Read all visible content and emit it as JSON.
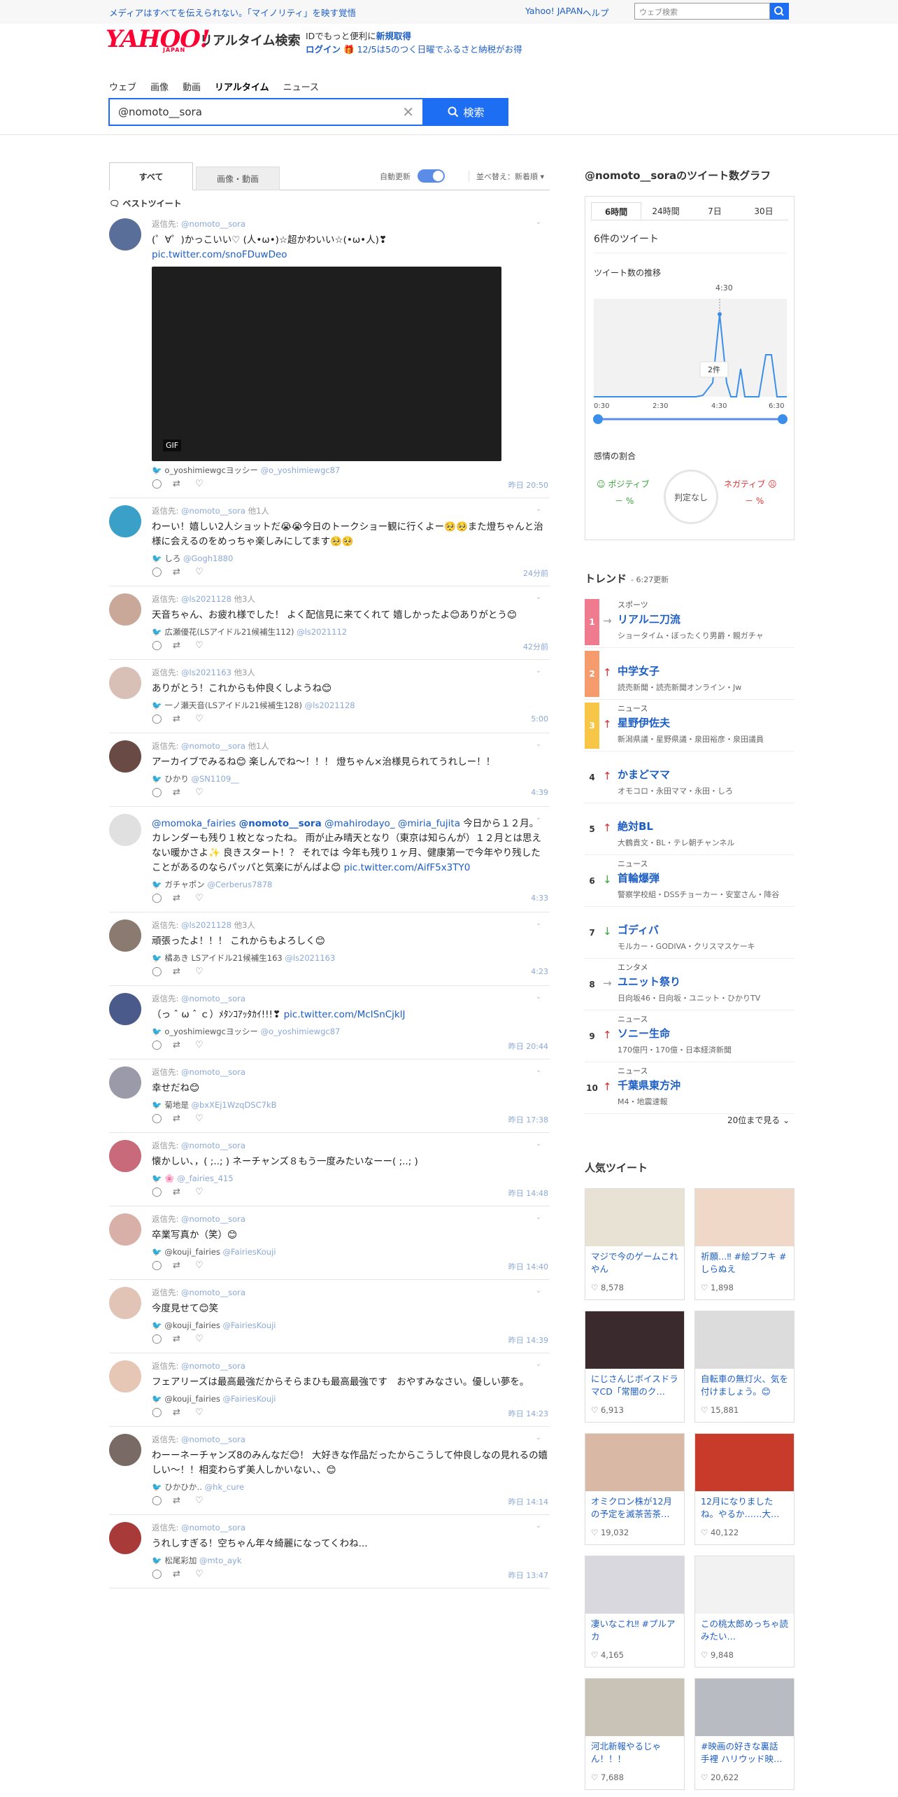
{
  "topbar": {
    "promo": "メディアはすべてを伝えられない。「マイノリティ」を映す覚悟",
    "yahoo_japan": "Yahoo! JAPAN",
    "help": "ヘルプ",
    "search_placeholder": "ウェブ検索"
  },
  "header": {
    "logo_text": "YAHOO!",
    "logo_sub": "JAPAN",
    "site_title": "リアルタイム検索",
    "promo_line1_a": "IDでもっと便利に",
    "promo_line1_b": "新規取得",
    "promo_line2_a": "ログイン",
    "promo_line2_b": "12/5は5のつく日曜でふるさと納税がお得"
  },
  "nav": [
    "ウェブ",
    "画像",
    "動画",
    "リアルタイム",
    "ニュース"
  ],
  "search": {
    "query": "@nomoto__sora",
    "button": "検索"
  },
  "tabs": {
    "all": "すべて",
    "media": "画像・動画",
    "auto_update": "自動更新",
    "sort": "並べ替え：新着順"
  },
  "best_label": "ベストツイート",
  "tweets": [
    {
      "reply_prefix": "返信先:",
      "reply": "@nomoto__sora",
      "reply_extra": "",
      "text": "(゜∀゜)かっこいい♡ (人•ω•)☆超かわいい☆(•ω•人)❣",
      "link": "pic.twitter.com/snoFDuwDeo",
      "has_gif": true,
      "gif_label": "GIF",
      "user_name": "o_yoshimiewgcヨッシー",
      "user_handle": "@o_yoshimiewgc87",
      "time": "昨日 20:50"
    },
    {
      "reply_prefix": "返信先:",
      "reply": "@nomoto__sora",
      "reply_extra": "他1人",
      "text": "わーい！嬉しい2人ショットだ😭😭今日のトークショー観に行くよー🥺🥺また燈ちゃんと治様に会えるのをめっちゃ楽しみにしてます🥺🥺",
      "link": "",
      "has_gif": false,
      "user_name": "しろ",
      "user_handle": "@Gogh1880",
      "time": "24分前"
    },
    {
      "reply_prefix": "返信先:",
      "reply": "@ls2021128",
      "reply_extra": "他3人",
      "text": "天音ちゃん、お疲れ様でした！ よく配信見に来てくれて 嬉しかったよ😊ありがとう😊",
      "link": "",
      "has_gif": false,
      "user_name": "広瀬優花(LSアイドル21候補生112)",
      "user_handle": "@ls2021112",
      "time": "42分前"
    },
    {
      "reply_prefix": "返信先:",
      "reply": "@ls2021163",
      "reply_extra": "他3人",
      "text": "ありがとう！これからも仲良くしようね😊",
      "link": "",
      "has_gif": false,
      "user_name": "一ノ瀬天音(LSアイドル21候補生128)",
      "user_handle": "@ls2021128",
      "time": "5:00"
    },
    {
      "reply_prefix": "返信先:",
      "reply": "@nomoto__sora",
      "reply_extra": "他1人",
      "text": "アーカイブでみるね😊 楽しんでね〜！！！ 燈ちゃん×治様見られてうれしー！！",
      "link": "",
      "has_gif": false,
      "user_name": "ひかり",
      "user_handle": "@SN1109__",
      "time": "4:39"
    },
    {
      "reply_prefix": "",
      "reply": "",
      "reply_extra": "",
      "text_rich": true,
      "m1": "@momoka_fairies",
      "m2": "@nomoto__sora",
      "m3": "@mahirodayo_",
      "m4": "@miria_fujita",
      "text": "今日から１２月。 カレンダーも残り１枚となったね。 雨が止み晴天となり（東京は知らんが）１２月とは思えない暖かさよ✨ 良きスタート！？ それでは 今年も残り１ヶ月、健康第一で今年やり残したことがあるのならパッパと気楽にがんばよ😊",
      "link": "pic.twitter.com/AifF5x3TY0",
      "has_gif": false,
      "user_name": "ガチャポン",
      "user_handle": "@Cerberus7878",
      "time": "4:33"
    },
    {
      "reply_prefix": "返信先:",
      "reply": "@ls2021128",
      "reply_extra": "他3人",
      "text": "頑張ったよ！！！ これからもよろしく😊",
      "link": "",
      "has_gif": false,
      "user_name": "橘あき LSアイドル21候補生163",
      "user_handle": "@ls2021163",
      "time": "4:23"
    },
    {
      "reply_prefix": "返信先:",
      "reply": "@nomoto__sora",
      "reply_extra": "",
      "text": "（っ ˆ ω ˆ ｃ）ﾒﾀﾝｺｱｯﾀｶｲ!!!❣",
      "link": "pic.twitter.com/McISnCjklJ",
      "has_gif": false,
      "user_name": "o_yoshimiewgcヨッシー",
      "user_handle": "@o_yoshimiewgc87",
      "time": "昨日 20:44"
    },
    {
      "reply_prefix": "返信先:",
      "reply": "@nomoto__sora",
      "reply_extra": "",
      "text": "幸せだね😊",
      "link": "",
      "has_gif": false,
      "user_name": "菊地是",
      "user_handle": "@bxXEj1WzqDSC7kB",
      "time": "昨日 17:38"
    },
    {
      "reply_prefix": "返信先:",
      "reply": "@nomoto__sora",
      "reply_extra": "",
      "text": "懐かしい、，( ;..; ) ネーチャンズ８もう一度みたいなーー( ;..; )",
      "link": "",
      "has_gif": false,
      "user_name": "🌸",
      "user_handle": "@_fairies_415",
      "time": "昨日 14:48"
    },
    {
      "reply_prefix": "返信先:",
      "reply": "@nomoto__sora",
      "reply_extra": "",
      "text": "卒業写真か（笑）😊",
      "link": "",
      "has_gif": false,
      "user_name": "@kouji_fairies",
      "user_handle": "@FairiesKouji",
      "time": "昨日 14:40"
    },
    {
      "reply_prefix": "返信先:",
      "reply": "@nomoto__sora",
      "reply_extra": "",
      "text": "今度見せて😊笑",
      "link": "",
      "has_gif": false,
      "user_name": "@kouji_fairies",
      "user_handle": "@FairiesKouji",
      "time": "昨日 14:39"
    },
    {
      "reply_prefix": "返信先:",
      "reply": "@nomoto__sora",
      "reply_extra": "",
      "text": "フェアリーズは最高最強だからそらまひも最高最強です　おやすみなさい。優しい夢を。",
      "link": "",
      "has_gif": false,
      "user_name": "@kouji_fairies",
      "user_handle": "@FairiesKouji",
      "time": "昨日 14:23"
    },
    {
      "reply_prefix": "返信先:",
      "reply": "@nomoto__sora",
      "reply_extra": "",
      "text": "わーーネーチャンズ8のみんなだ😊！ 大好きな作品だったからこうして仲良しなの見れるの嬉しい〜！！相変わらず美人しかいない、、😊",
      "link": "",
      "has_gif": false,
      "user_name": "ひかひか‥",
      "user_handle": "@hk_cure",
      "time": "昨日 14:14"
    },
    {
      "reply_prefix": "返信先:",
      "reply": "@nomoto__sora",
      "reply_extra": "",
      "text": "うれしすぎる！空ちゃん年々綺麗になってくわね...",
      "link": "",
      "has_gif": false,
      "user_name": "松尾彩加",
      "user_handle": "@mto_ayk",
      "time": "昨日 13:47"
    }
  ],
  "graph": {
    "title": "@nomoto__soraのツイート数グラフ",
    "tabs": [
      "6時間",
      "24時間",
      "7日",
      "30日"
    ],
    "count_text": "6件のツイート",
    "trend_label": "ツイート数の推移",
    "peak_label": "4:30",
    "tooltip": "2件",
    "axis": [
      "0:30",
      "2:30",
      "4:30",
      "6:30"
    ],
    "sentiment_title": "感情の割合",
    "positive": "ポジティブ",
    "negative": "ネガティブ",
    "pos_val": "－ %",
    "neg_val": "－ %",
    "neutral": "判定なし"
  },
  "trends_header": {
    "title": "トレンド",
    "updated": "6:27更新"
  },
  "trends": [
    {
      "rank": "1",
      "arrow": "→",
      "arrow_color": "#999999",
      "cat": "スポーツ",
      "name": "リアル二刀流",
      "rel": "ショータイム・ぼったくり男爵・親ガチャ"
    },
    {
      "rank": "2",
      "arrow": "↑",
      "arrow_color": "#d33333",
      "cat": "",
      "name": "中学女子",
      "rel": "読売新聞・読売新聞オンライン・Jw"
    },
    {
      "rank": "3",
      "arrow": "↑",
      "arrow_color": "#d33333",
      "cat": "ニュース",
      "name": "星野伊佐夫",
      "rel": "新潟県議・星野県議・泉田裕彦・泉田議員"
    },
    {
      "rank": "4",
      "arrow": "↑",
      "arrow_color": "#d33333",
      "cat": "",
      "name": "かまどママ",
      "rel": "オモコロ・永田ママ・永田・しろ"
    },
    {
      "rank": "5",
      "arrow": "↑",
      "arrow_color": "#d33333",
      "cat": "",
      "name": "絶対BL",
      "rel": "大鶴貴文・BL・テレ朝チャンネル"
    },
    {
      "rank": "6",
      "arrow": "↓",
      "arrow_color": "#3aa33a",
      "cat": "ニュース",
      "name": "首輪爆弾",
      "rel": "警察学校組・DSSチョーカー・安室さん・降谷"
    },
    {
      "rank": "7",
      "arrow": "↓",
      "arrow_color": "#3aa33a",
      "cat": "",
      "name": "ゴディバ",
      "rel": "モルカー・GODIVA・クリスマスケーキ"
    },
    {
      "rank": "8",
      "arrow": "→",
      "arrow_color": "#999999",
      "cat": "エンタメ",
      "name": "ユニット祭り",
      "rel": "日向坂46・日向坂・ユニット・ひかりTV"
    },
    {
      "rank": "9",
      "arrow": "↑",
      "arrow_color": "#d33333",
      "cat": "ニュース",
      "name": "ソニー生命",
      "rel": "170億円・170億・日本経済新聞"
    },
    {
      "rank": "10",
      "arrow": "↑",
      "arrow_color": "#d33333",
      "cat": "ニュース",
      "name": "千葉県東方沖",
      "rel": "M4・地震速報"
    }
  ],
  "trend_more": "20位まで見る",
  "popular_title": "人気ツイート",
  "popular": [
    {
      "text": "マジで今のゲームこれやん",
      "likes": "8,578",
      "color": "#e8e2d4"
    },
    {
      "text": "祈願…‼ #絵ブフキ #しらぬえ",
      "likes": "1,898",
      "color": "#f0d8c8"
    },
    {
      "text": "にじさんじボイスドラマCD「常闇のク…",
      "likes": "6,913",
      "color": "#3a2a2e"
    },
    {
      "text": "自転車の無灯火、気を付けましょう。😊",
      "likes": "15,881",
      "color": "#dcdcdc"
    },
    {
      "text": "オミクロン株が12月の予定を滅茶苦茶…",
      "likes": "19,032",
      "color": "#d9b8a6"
    },
    {
      "text": "12月になりましたね。やるか……大…",
      "likes": "40,122",
      "color": "#c83a2a"
    },
    {
      "text": "凄いなこれ‼ #プルアカ",
      "likes": "4,165",
      "color": "#d8d8de"
    },
    {
      "text": "この桃太郎めっちゃ読みたい…",
      "likes": "9,848",
      "color": "#f2f2f2"
    },
    {
      "text": "河北新報やるじゃん！！！",
      "likes": "7,688",
      "color": "#c9c2b6"
    },
    {
      "text": "#映画の好きな裏話 手裡 ハリウッド映…",
      "likes": "20,622",
      "color": "#b8bcc2"
    }
  ],
  "colors": {
    "accent": "#1d6ef3",
    "link": "#1d5ec5",
    "brand": "#ff0033"
  }
}
